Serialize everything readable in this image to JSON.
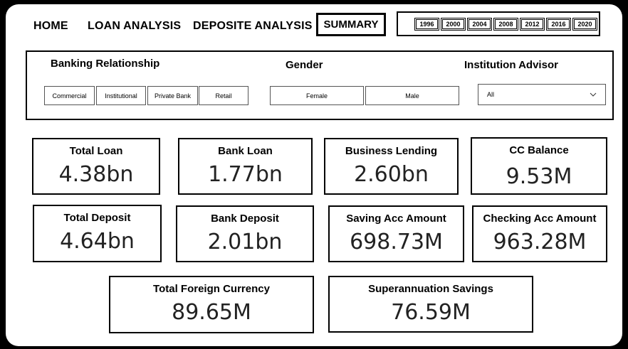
{
  "nav": {
    "home": "HOME",
    "loan_analysis": "LOAN ANALYSIS",
    "deposite_analysis": "DEPOSITE ANALYSIS",
    "summary": "SUMMARY"
  },
  "years": [
    "1996",
    "2000",
    "2004",
    "2008",
    "2012",
    "2016",
    "2020"
  ],
  "filters": {
    "banking_relationship": {
      "title": "Banking Relationship",
      "options": [
        "Commercial",
        "Institutional",
        "Private Bank",
        "Retail"
      ]
    },
    "gender": {
      "title": "Gender",
      "options": [
        "Female",
        "Male"
      ]
    },
    "institution_advisor": {
      "title": "Institution Advisor",
      "selected": "All"
    }
  },
  "cards": {
    "total_loan": {
      "label": "Total Loan",
      "value": "4.38bn"
    },
    "bank_loan": {
      "label": "Bank Loan",
      "value": "1.77bn"
    },
    "business_lending": {
      "label": "Business Lending",
      "value": "2.60bn"
    },
    "cc_balance": {
      "label": "CC Balance",
      "value": "9.53M"
    },
    "total_deposit": {
      "label": "Total Deposit",
      "value": "4.64bn"
    },
    "bank_deposit": {
      "label": "Bank Deposit",
      "value": "2.01bn"
    },
    "saving_acc_amount": {
      "label": "Saving Acc Amount",
      "value": "698.73M"
    },
    "checking_acc_amount": {
      "label": "Checking Acc Amount",
      "value": "963.28M"
    },
    "total_foreign_currency": {
      "label": "Total Foreign Currency",
      "value": "89.65M"
    },
    "superannuation_savings": {
      "label": "Superannuation Savings",
      "value": "76.59M"
    }
  }
}
